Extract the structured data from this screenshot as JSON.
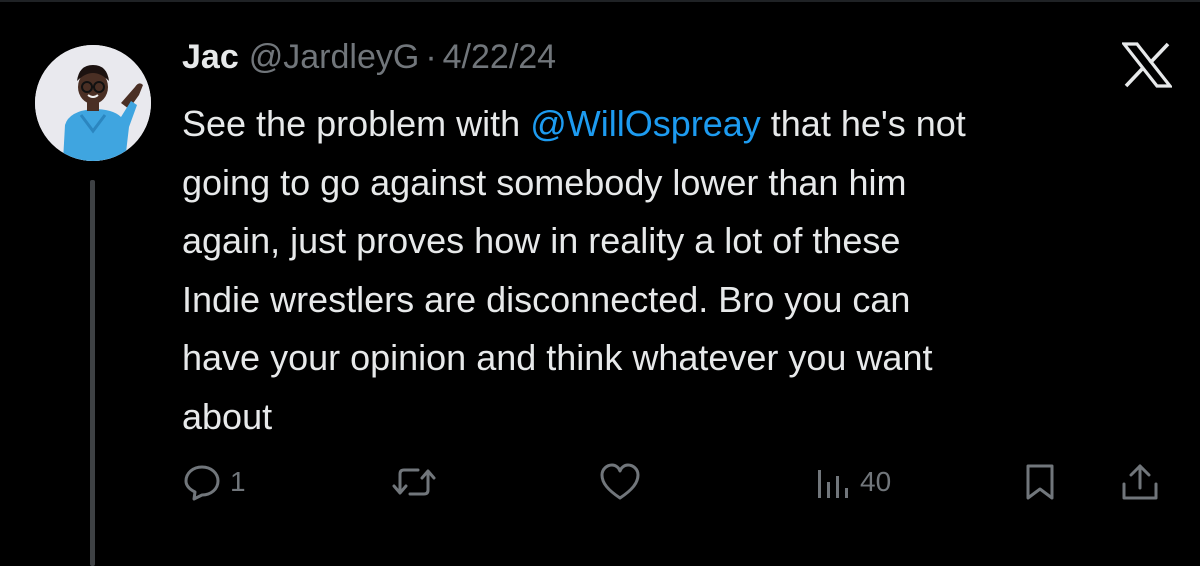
{
  "tweet": {
    "author_name": "Jac",
    "author_handle": "@JardleyG",
    "separator": "·",
    "date": "4/22/24",
    "text_lines": [
      [
        "See the problem with ",
        "@WillOspreay",
        " that he's not"
      ],
      "going to go against somebody lower than him",
      "again, just proves how in reality a lot of these",
      "Indie wrestlers are disconnected. Bro you can",
      "have your opinion and think whatever you want",
      "about"
    ],
    "mention": "@WillOspreay"
  },
  "actions": {
    "reply_count": "1",
    "retweet_count": "",
    "like_count": "",
    "views_count": "40"
  },
  "icons": {
    "platform_logo": "x-logo-icon",
    "reply": "reply-icon",
    "retweet": "retweet-icon",
    "like": "heart-icon",
    "views": "views-icon",
    "bookmark": "bookmark-icon",
    "share": "share-icon"
  },
  "colors": {
    "background": "#000000",
    "text": "#e7e9ea",
    "secondary": "#71767b",
    "accent": "#1d9bf0"
  }
}
